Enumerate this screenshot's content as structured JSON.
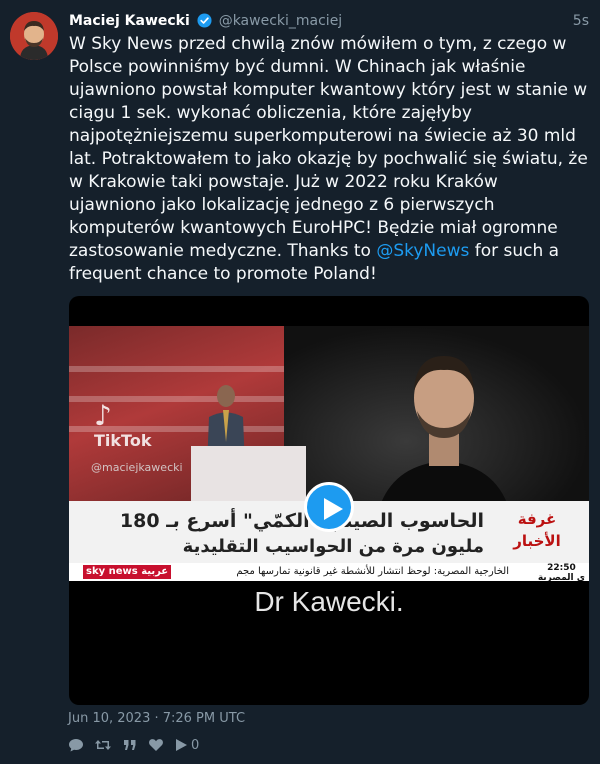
{
  "author": {
    "name": "Maciej Kawecki",
    "handle": "@kawecki_maciej",
    "verified": true
  },
  "time_ago": "5s",
  "tweet": {
    "text_before_mention": "W Sky News przed chwilą znów mówiłem o tym, z czego w Polsce powinniśmy być dumni. W Chinach jak właśnie ujawniono powstał komputer kwantowy który jest w stanie w ciągu 1 sek. wykonać obliczenia, które zajęłyby najpotężniejszemu superkomputerowi na świecie aż 30 mld lat. Potraktowałem to jako okazję by pochwalić się światu, że w Krakowie taki powstaje. Już w 2022 roku Kraków ujawniono jako lokalizację jednego z 6 pierwszych komputerów kwantowych EuroHPC! Będzie miał ogromne zastosowanie medyczne. Thanks to ",
    "mention": "@SkyNews",
    "text_after_mention": " for such a frequent chance to promote Poland!"
  },
  "media": {
    "watermark_brand": "TikTok",
    "watermark_handle": "@maciejkawecki",
    "caption_line1": "الحاسوب الصيني \"الكمّي\" أسرع بـ 180",
    "caption_line2": "مليون مرة من الحواسيب التقليدية",
    "channel_name_line1": "غرفة",
    "channel_name_line2": "الأخبار",
    "ticker_logo": "sky news عربية",
    "ticker_text": "الخارجية المصرية: لوحظ انتشار للأنشطة غير قانونية تمارسها مجم",
    "ticker_right": "ي المصرية",
    "ticker_time": "22:50",
    "subtitle": "Dr Kawecki."
  },
  "posted_at": "Jun 10, 2023 · 7:26 PM UTC",
  "actions": {
    "views_count": "0"
  },
  "colors": {
    "background": "#15202b",
    "accent": "#1d9bf0",
    "muted": "#8899a6"
  },
  "icons": [
    "verified-badge-icon",
    "reply-icon",
    "retweet-icon",
    "quote-icon",
    "like-icon",
    "play-icon"
  ]
}
